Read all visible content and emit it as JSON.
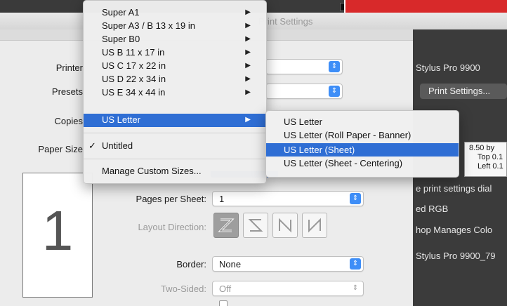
{
  "back_window": {
    "title": "Print Settings"
  },
  "dialog": {
    "printer_label": "Printer",
    "presets_label": "Presets",
    "copies_label": "Copies",
    "paper_size_label": "Paper Size",
    "pages_per_sheet_label": "Pages per Sheet:",
    "pages_per_sheet_value": "1",
    "layout_direction_label": "Layout Direction:",
    "border_label": "Border:",
    "border_value": "None",
    "two_sided_label": "Two-Sided:",
    "two_sided_value": "Off",
    "preview_page_number": "1"
  },
  "paper_menu": {
    "items": [
      {
        "label": "Super A1"
      },
      {
        "label": "Super A3 / B 13 x 19 in"
      },
      {
        "label": "Super B0"
      },
      {
        "label": "US B 11 x 17 in"
      },
      {
        "label": "US C 17 x 22 in"
      },
      {
        "label": "US D 22 x 34 in"
      },
      {
        "label": "US E 34 x 44 in"
      },
      {
        "label": "US Letter"
      }
    ],
    "checked_item": "Untitled",
    "manage_label": "Manage Custom Sizes..."
  },
  "letter_submenu": {
    "items": [
      {
        "label": "US Letter"
      },
      {
        "label": "US Letter (Roll Paper - Banner)"
      },
      {
        "label": "US Letter (Sheet)"
      },
      {
        "label": "US Letter (Sheet - Centering)"
      }
    ]
  },
  "right_panel": {
    "printer_name": "Stylus Pro 9900",
    "print_settings_button": "Print Settings...",
    "info_line1": "8.50 by",
    "info_line2": "Top 0.1",
    "info_line3": "Left 0.1",
    "text_print_settings": "e print settings dial",
    "text_rgb": "ed RGB",
    "text_color": "hop Manages Colo",
    "text_profile": "Stylus Pro 9900_79"
  },
  "colors": {
    "highlight": "#2f6ed4",
    "stepper": "#3e8ef7"
  }
}
